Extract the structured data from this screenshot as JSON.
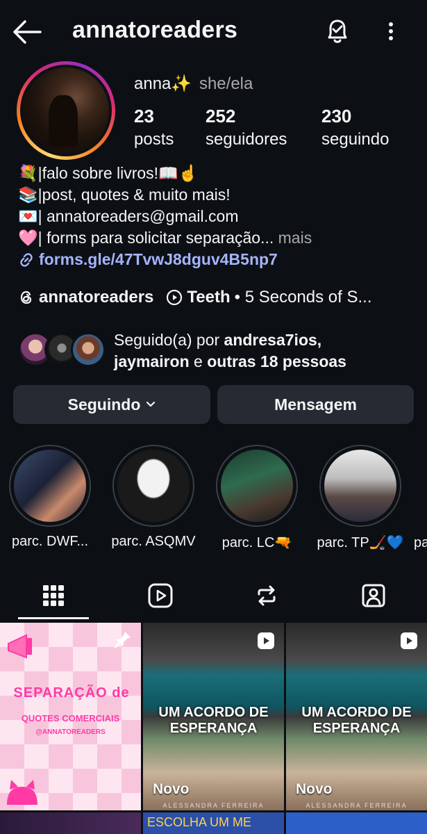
{
  "header": {
    "title": "annatoreaders"
  },
  "profile": {
    "name": "anna✨",
    "pronouns": "she/ela",
    "stats": [
      {
        "value": "23",
        "label": "posts"
      },
      {
        "value": "252",
        "label": "seguidores"
      },
      {
        "value": "230",
        "label": "seguindo"
      }
    ]
  },
  "bio": {
    "lines": [
      "💐|falo sobre livros!📖☝️",
      "📚|post, quotes & muito mais!",
      "💌| annatoreaders@gmail.com",
      "🩷| forms para solicitar separação..."
    ],
    "more": "mais",
    "link": "forms.gle/47TvwJ8dguv4B5np7"
  },
  "meta": {
    "threads_handle": "annatoreaders",
    "song": "Teeth",
    "artist": "• 5 Seconds of S..."
  },
  "followed_by": {
    "prefix": "Seguido(a) por",
    "user1": "andresa7ios,",
    "user2": "jaymairon",
    "joiner": "e",
    "others": "outras 18 pessoas"
  },
  "buttons": {
    "following": "Seguindo",
    "message": "Mensagem"
  },
  "highlights": [
    {
      "label": "parc. DWF..."
    },
    {
      "label": "parc. ASQMV"
    },
    {
      "label": "parc. LC🔫"
    },
    {
      "label": "parc. TP🏒💙"
    },
    {
      "label": "pa"
    }
  ],
  "tabs": [
    "grid-icon",
    "reels-icon",
    "reposts-icon",
    "tagged-icon"
  ],
  "posts": [
    {
      "title": "SEPARAÇÃO de",
      "subtitle": "QUOTES COMERCIAIS",
      "handle": "@ANNATOREADERS"
    },
    {
      "title": "UM ACORDO DE ESPERANÇA",
      "badge": "Novo",
      "author": "ALESSANDRA FERREIRA"
    },
    {
      "title": "UM ACORDO DE ESPERANÇA",
      "badge": "Novo",
      "author": "ALESSANDRA FERREIRA"
    },
    {
      "title": "ESCOLHA UM ME"
    }
  ],
  "colors": {
    "background": "#0c1014",
    "button": "#262b33",
    "link": "#a5b4fc",
    "secondary_text": "#a8a8a8"
  }
}
